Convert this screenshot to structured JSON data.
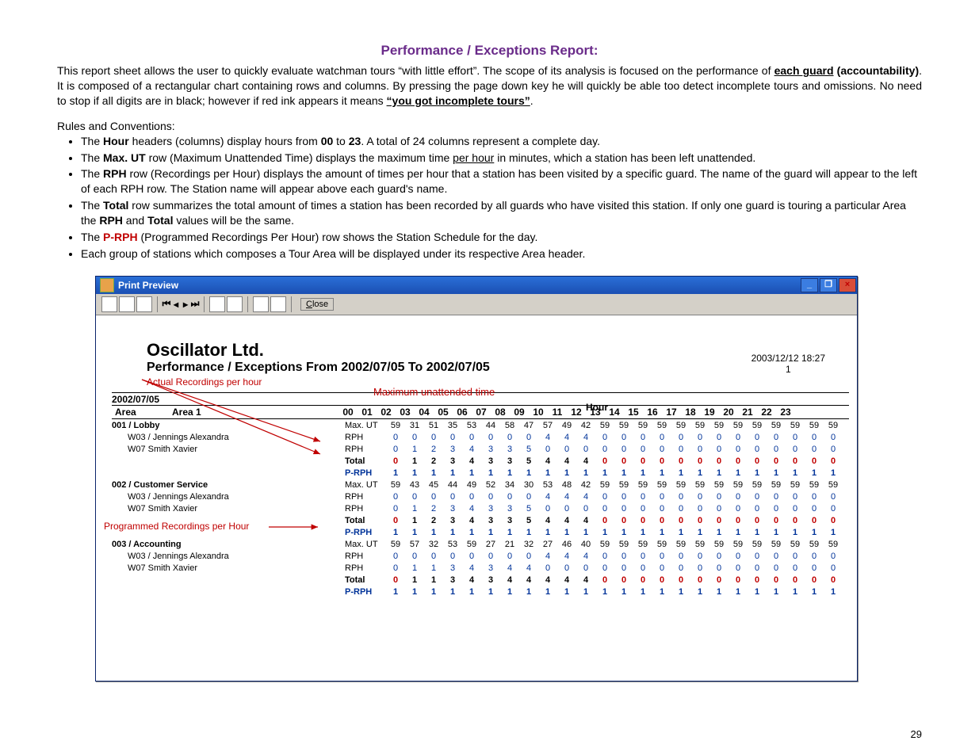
{
  "doc": {
    "title": "Performance / Exceptions Report:",
    "intro_html": "This report sheet allows the user to quickly evaluate watchman tours “with little effort”. The scope of its analysis is focused on the performance of <span class='bub'>each guard</span> <b>(accountability)</b>. It is composed of a rectangular chart containing rows and columns. By pressing the page down key he will quickly be able too detect incomplete tours and omissions. No need to stop if all digits are in black; however if red ink appears it means <span class='bub'>“you got incomplete tours”</span>.",
    "rules_label": "Rules and Conventions:",
    "rules": [
      "The <b>Hour</b> headers (columns) display hours from <b>00</b> to <b>23</b>. A total of 24 columns represent a complete day.",
      "The <b>Max. UT</b> row (Maximum Unattended Time) displays the maximum time <span class='u'>per hour</span> in minutes, which a station has been left unattended.",
      "The <b>RPH</b> row (Recordings per Hour) displays the amount of times per hour that a station has been visited by a specific guard. The name of the guard will appear to the left of each RPH row. The Station name will appear above each guard's name.",
      "The <b>Total</b> row summarizes the total amount of times a station has been recorded by all guards who have visited this station. If only one guard is touring a particular Area the <b>RPH</b> and <b>Total</b> values will be the same.",
      "The <span class='prph'>P-RPH</span> (Programmed Recordings Per Hour) row shows the Station Schedule for the day.",
      "Each group of stations which composes a Tour Area will be displayed under its respective Area header."
    ],
    "page_number": "29"
  },
  "window": {
    "title": "Print Preview",
    "close": "Close"
  },
  "report": {
    "company": "Oscillator Ltd.",
    "range": "Performance / Exceptions From 2002/07/05 To 2002/07/05",
    "datetime": "2003/12/12 18:27",
    "page": "1",
    "actual_label": "Actual Recordings per hour",
    "mut_label": "Maximum unattended time",
    "hour_label": "Hour",
    "date": "2002/07/05",
    "area_label": "Area",
    "area_name": "Area 1",
    "hours": [
      "00",
      "01",
      "02",
      "03",
      "04",
      "05",
      "06",
      "07",
      "08",
      "09",
      "10",
      "11",
      "12",
      "13",
      "14",
      "15",
      "16",
      "17",
      "18",
      "19",
      "20",
      "21",
      "22",
      "23"
    ],
    "annot_prph": "Programmed Recordings per Hour"
  },
  "chart_data": [
    {
      "station": "001 / Lobby",
      "rows": [
        {
          "label": "Max. UT",
          "style": "black",
          "values": [
            59,
            31,
            51,
            35,
            53,
            44,
            58,
            47,
            57,
            49,
            42,
            59,
            59,
            59,
            59,
            59,
            59,
            59,
            59,
            59,
            59,
            59,
            59,
            59
          ]
        },
        {
          "label": "RPH",
          "guard": "W03 / Jennings Alexandra",
          "style": "blue",
          "values": [
            0,
            0,
            0,
            0,
            0,
            0,
            0,
            0,
            4,
            4,
            4,
            0,
            0,
            0,
            0,
            0,
            0,
            0,
            0,
            0,
            0,
            0,
            0,
            0
          ]
        },
        {
          "label": "RPH",
          "guard": "W07 Smith Xavier",
          "style": "blue",
          "values": [
            0,
            1,
            2,
            3,
            4,
            3,
            3,
            5,
            0,
            0,
            0,
            0,
            0,
            0,
            0,
            0,
            0,
            0,
            0,
            0,
            0,
            0,
            0,
            0
          ]
        },
        {
          "label": "Total",
          "style": "total",
          "values": [
            0,
            1,
            2,
            3,
            4,
            3,
            3,
            5,
            4,
            4,
            4,
            0,
            0,
            0,
            0,
            0,
            0,
            0,
            0,
            0,
            0,
            0,
            0,
            0
          ]
        },
        {
          "label": "P-RPH",
          "style": "blue-bold",
          "values": [
            1,
            1,
            1,
            1,
            1,
            1,
            1,
            1,
            1,
            1,
            1,
            1,
            1,
            1,
            1,
            1,
            1,
            1,
            1,
            1,
            1,
            1,
            1,
            1
          ]
        }
      ]
    },
    {
      "station": "002 / Customer Service",
      "rows": [
        {
          "label": "Max. UT",
          "style": "black",
          "values": [
            59,
            43,
            45,
            44,
            49,
            52,
            34,
            30,
            53,
            48,
            42,
            59,
            59,
            59,
            59,
            59,
            59,
            59,
            59,
            59,
            59,
            59,
            59,
            59
          ]
        },
        {
          "label": "RPH",
          "guard": "W03 / Jennings Alexandra",
          "style": "blue",
          "values": [
            0,
            0,
            0,
            0,
            0,
            0,
            0,
            0,
            4,
            4,
            4,
            0,
            0,
            0,
            0,
            0,
            0,
            0,
            0,
            0,
            0,
            0,
            0,
            0
          ]
        },
        {
          "label": "RPH",
          "guard": "W07 Smith Xavier",
          "style": "blue",
          "values": [
            0,
            1,
            2,
            3,
            4,
            3,
            3,
            5,
            0,
            0,
            0,
            0,
            0,
            0,
            0,
            0,
            0,
            0,
            0,
            0,
            0,
            0,
            0,
            0
          ]
        },
        {
          "label": "Total",
          "style": "total",
          "values": [
            0,
            1,
            2,
            3,
            4,
            3,
            3,
            5,
            4,
            4,
            4,
            0,
            0,
            0,
            0,
            0,
            0,
            0,
            0,
            0,
            0,
            0,
            0,
            0
          ]
        },
        {
          "label": "P-RPH",
          "style": "blue-bold",
          "values": [
            1,
            1,
            1,
            1,
            1,
            1,
            1,
            1,
            1,
            1,
            1,
            1,
            1,
            1,
            1,
            1,
            1,
            1,
            1,
            1,
            1,
            1,
            1,
            1
          ]
        }
      ]
    },
    {
      "station": "003 / Accounting",
      "rows": [
        {
          "label": "Max. UT",
          "style": "black",
          "values": [
            59,
            57,
            32,
            53,
            59,
            27,
            21,
            32,
            27,
            46,
            40,
            59,
            59,
            59,
            59,
            59,
            59,
            59,
            59,
            59,
            59,
            59,
            59,
            59
          ]
        },
        {
          "label": "RPH",
          "guard": "W03 / Jennings Alexandra",
          "style": "blue",
          "values": [
            0,
            0,
            0,
            0,
            0,
            0,
            0,
            0,
            4,
            4,
            4,
            0,
            0,
            0,
            0,
            0,
            0,
            0,
            0,
            0,
            0,
            0,
            0,
            0
          ]
        },
        {
          "label": "RPH",
          "guard": "W07 Smith Xavier",
          "style": "blue",
          "values": [
            0,
            1,
            1,
            3,
            4,
            3,
            4,
            4,
            0,
            0,
            0,
            0,
            0,
            0,
            0,
            0,
            0,
            0,
            0,
            0,
            0,
            0,
            0,
            0
          ]
        },
        {
          "label": "Total",
          "style": "total",
          "values": [
            0,
            1,
            1,
            3,
            4,
            3,
            4,
            4,
            4,
            4,
            4,
            0,
            0,
            0,
            0,
            0,
            0,
            0,
            0,
            0,
            0,
            0,
            0,
            0
          ]
        },
        {
          "label": "P-RPH",
          "style": "blue-bold",
          "values": [
            1,
            1,
            1,
            1,
            1,
            1,
            1,
            1,
            1,
            1,
            1,
            1,
            1,
            1,
            1,
            1,
            1,
            1,
            1,
            1,
            1,
            1,
            1,
            1
          ]
        }
      ]
    }
  ]
}
